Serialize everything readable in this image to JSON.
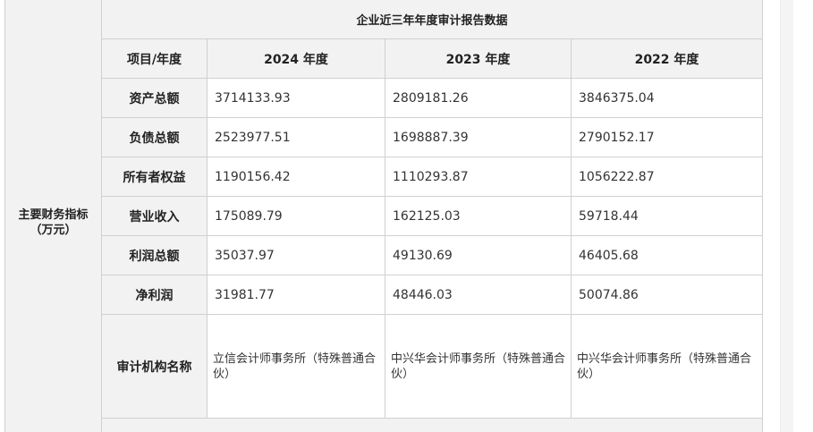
{
  "section_label": "主要财务指标（万元）",
  "table_caption": "企业近三年年度审计报告数据",
  "header": {
    "item_year": "项目/年度",
    "years": [
      "2024 年度",
      "2023 年度",
      "2022 年度"
    ]
  },
  "rows": [
    {
      "label": "资产总额",
      "values": [
        "3714133.93",
        "2809181.26",
        "3846375.04"
      ]
    },
    {
      "label": "负债总额",
      "values": [
        "2523977.51",
        "1698887.39",
        "2790152.17"
      ]
    },
    {
      "label": "所有者权益",
      "values": [
        "1190156.42",
        "1110293.87",
        "1056222.87"
      ]
    },
    {
      "label": "营业收入",
      "values": [
        "175089.79",
        "162125.03",
        "59718.44"
      ]
    },
    {
      "label": "利润总额",
      "values": [
        "35037.97",
        "49130.69",
        "46405.68"
      ]
    },
    {
      "label": "净利润",
      "values": [
        "31981.77",
        "48446.03",
        "50074.86"
      ]
    }
  ],
  "auditor_row": {
    "label": "审计机构名称",
    "values": [
      "立信会计师事务所（特殊普通合伙）",
      "中兴华会计师事务所（特殊普通合伙）",
      "中兴华会计师事务所（特殊普通合伙）"
    ]
  }
}
